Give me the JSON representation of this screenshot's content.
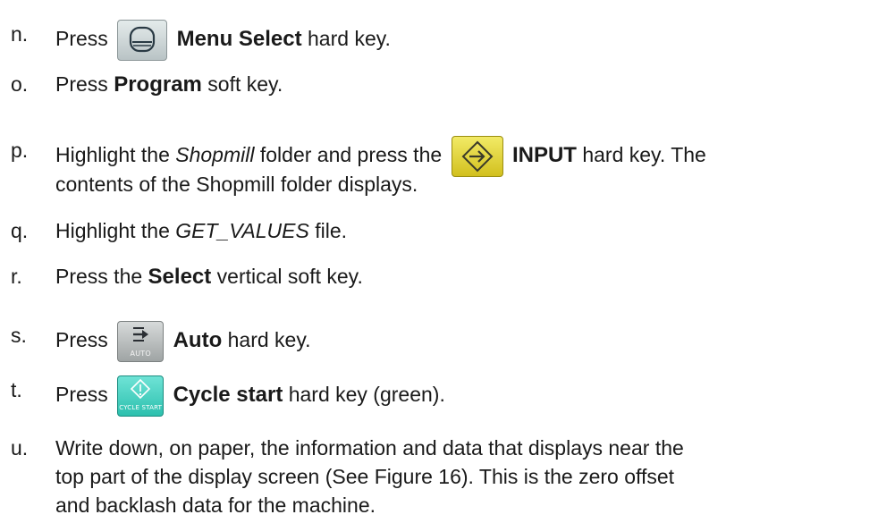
{
  "steps": [
    {
      "marker": "n.",
      "press": "Press",
      "key_name": "Menu Select",
      "key_suffix": " hard key.",
      "icon": "menu-select-key-icon"
    },
    {
      "marker": "o.",
      "press": "Press ",
      "key_name": "Program",
      "key_suffix": " soft key."
    },
    {
      "marker": "p.",
      "prefix": "Highlight the ",
      "folder": "Shopmill",
      "middle": " folder and press the",
      "key_name": "INPUT",
      "key_suffix": " hard key. The",
      "line2": "contents of the Shopmill folder displays.",
      "icon": "input-key-icon"
    },
    {
      "marker": "q.",
      "prefix": "Highlight the ",
      "file": "GET_VALUES",
      "suffix": " file."
    },
    {
      "marker": "r.",
      "prefix": "Press the ",
      "key_name": "Select",
      "key_suffix": " vertical soft key."
    },
    {
      "marker": "s.",
      "press": "Press",
      "key_name": "Auto",
      "key_suffix": " hard key.",
      "key_label": "AUTO",
      "icon": "auto-key-icon"
    },
    {
      "marker": "t.",
      "press": "Press",
      "key_name": "Cycle start",
      "key_suffix": " hard key (green).",
      "key_label": "CYCLE START",
      "icon": "cycle-start-key-icon"
    },
    {
      "marker": "u.",
      "lines": [
        "Write down, on paper, the information and data that displays near the",
        "top part of the display screen (See Figure 16). This is the zero offset",
        "and backlash data for the machine."
      ]
    }
  ],
  "colors": {
    "text": "#1a1a1a",
    "menu_key": "#c9d2d4",
    "input_key": "#e6d83a",
    "auto_key": "#b8bcbc",
    "cycle_start_key": "#45d1c1"
  }
}
